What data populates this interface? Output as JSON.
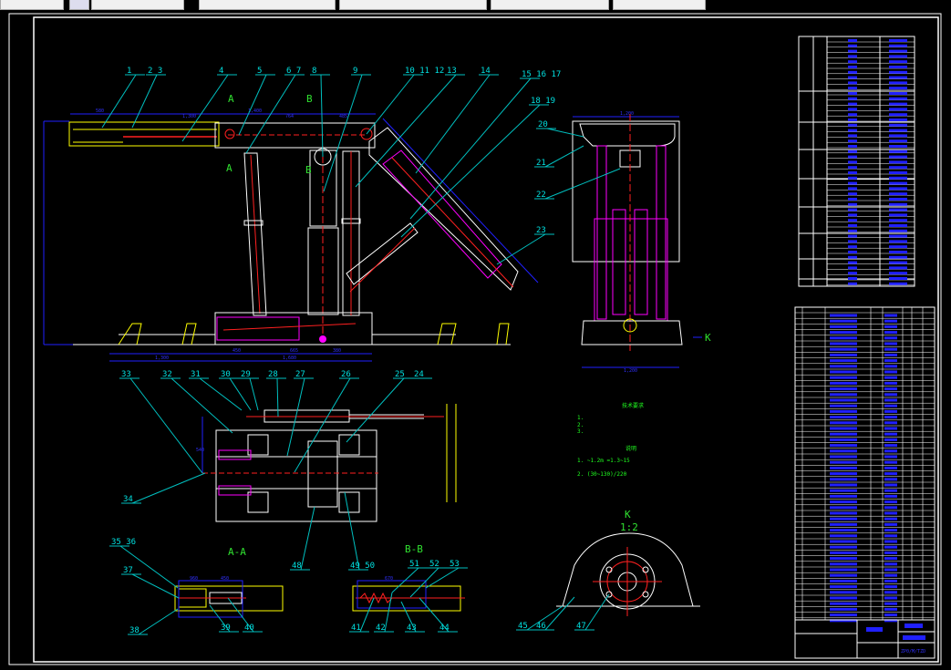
{
  "window": {
    "tabs": [
      {
        "label": ""
      },
      {
        "label": ""
      },
      {
        "label": ""
      },
      {
        "label": ""
      },
      {
        "label": ""
      },
      {
        "label": ""
      }
    ]
  },
  "drawing": {
    "colors": {
      "background": "#000000",
      "frame": "#ffffff",
      "callout": "#00e0e0",
      "section": "#30e030",
      "dimension": "#2020ff",
      "cylinder": "#ff00ff",
      "centerline": "#ff2020",
      "accent": "#ffff00"
    },
    "callouts_main": [
      "1",
      "2 3",
      "4",
      "5",
      "6 7",
      "8",
      "9",
      "10 11 12",
      "13",
      "14",
      "15 16 17",
      "18 19",
      "20",
      "21",
      "22",
      "23"
    ],
    "callouts_plan": [
      "33",
      "32",
      "31",
      "30",
      "29",
      "28",
      "27",
      "26",
      "25",
      "24",
      "34",
      "48",
      "49 50"
    ],
    "callouts_sections": [
      "35 36",
      "37",
      "38",
      "39",
      "40",
      "41",
      "42",
      "43",
      "44",
      "51",
      "52",
      "53",
      "45",
      "46",
      "47"
    ],
    "section_labels": {
      "a_a": "A-A",
      "b_b": "B-B",
      "k_view": "K",
      "k_scale": "1:2",
      "a_top": "A",
      "a_bottom": "A",
      "b_top": "B",
      "b_bottom": "B",
      "k_marker": "K"
    },
    "dimensions": {
      "top_left": "580",
      "top_1": "1,300",
      "top_2": "1,400",
      "top_3": "764",
      "top_4": "485",
      "base_1": "1,300",
      "base_2": "1,680",
      "base_3": "665",
      "base_4": "450",
      "base_5": "380",
      "front_width": "1,200",
      "front_base": "1,200",
      "plan_h": "540",
      "aa_1": "960",
      "aa_2": "450",
      "bb_1": "670"
    },
    "notes": {
      "heading1": "技术要求",
      "lines1": [
        "1.",
        "2.",
        "3."
      ],
      "heading2": "说明",
      "lines2": [
        "1. ~1.2m =1.3~15",
        "2. (30~130)/220"
      ]
    },
    "title_block": {
      "drawing_no": "ZP0/M/TZD"
    }
  }
}
